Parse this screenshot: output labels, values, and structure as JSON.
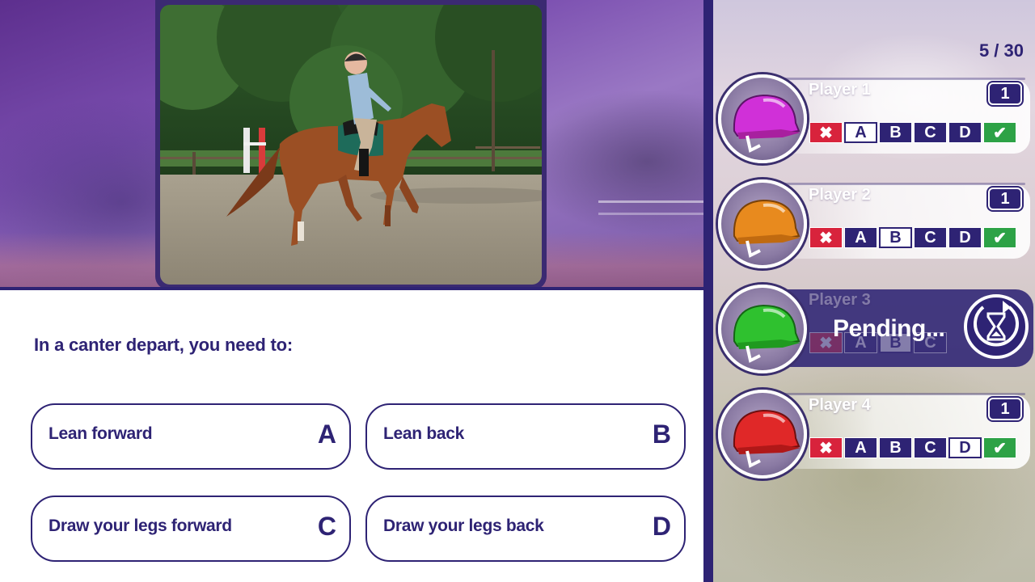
{
  "question": {
    "text": "In a canter depart, you need to:",
    "answers": [
      {
        "label": "Lean forward",
        "letter": "A"
      },
      {
        "label": "Lean back",
        "letter": "B"
      },
      {
        "label": "Draw your legs forward",
        "letter": "C"
      },
      {
        "label": "Draw your legs back",
        "letter": "D"
      }
    ]
  },
  "round": {
    "counter": "5 / 30"
  },
  "players": [
    {
      "name": "Player 1",
      "score": "1",
      "helmet_color": "#d030d8",
      "selected": "A",
      "status": "answered"
    },
    {
      "name": "Player 2",
      "score": "1",
      "helmet_color": "#e88a1e",
      "selected": "B",
      "status": "answered"
    },
    {
      "name": "Player 3",
      "score": "",
      "helmet_color": "#2fc12f",
      "selected": "B",
      "status": "pending",
      "pending_text": "Pending..."
    },
    {
      "name": "Player 4",
      "score": "1",
      "helmet_color": "#e02828",
      "selected": "D",
      "status": "answered"
    }
  ],
  "options": {
    "a": "A",
    "b": "B",
    "c": "C",
    "d": "D"
  },
  "icons": {
    "wrong": "x-mark-icon",
    "right": "check-mark-icon",
    "timer": "hourglass-timer-icon",
    "helmet": "riding-helmet-icon"
  },
  "colors": {
    "primary": "#2e2374",
    "wrong": "#d8233c",
    "right": "#2da246"
  }
}
